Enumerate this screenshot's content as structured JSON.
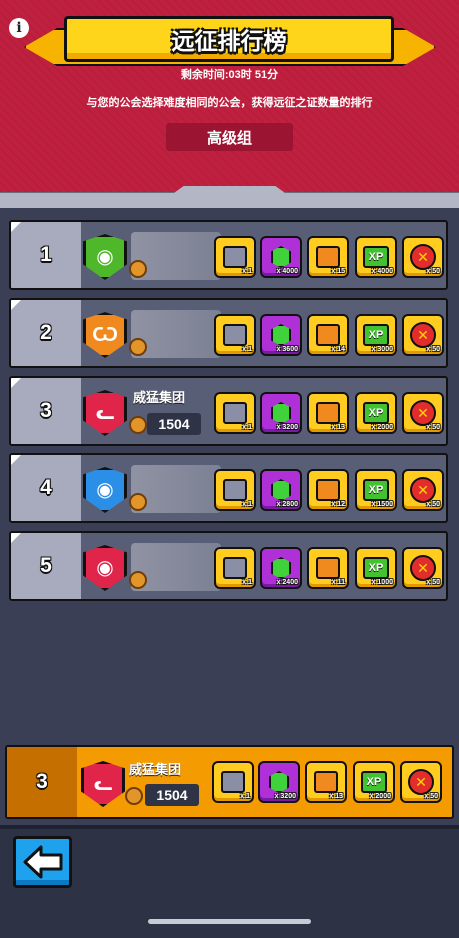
{
  "header": {
    "title": "远征排行榜",
    "remaining_time": "剩余时间:03时 51分",
    "description": "与您的公会选择难度相同的公会，获得远征之证数量的排行",
    "group_label": "高级组",
    "info_icon": "i"
  },
  "colors": {
    "header_red": "#c0203f",
    "title_yellow": "#ffd51c",
    "row_bg": "#585e76",
    "highlight_orange": "#f39b00",
    "back_blue": "#1fa2ee"
  },
  "rows": [
    {
      "rank": "1",
      "badge_color": "#4fb82a",
      "badge_icon": "raccoon-icon",
      "name": "",
      "trophies": "",
      "rewards": [
        "x 1",
        "x 4000",
        "x 15",
        "x 4000",
        "x 50"
      ]
    },
    {
      "rank": "2",
      "badge_color": "#f08a1e",
      "badge_icon": "bull-icon",
      "name": "",
      "trophies": "",
      "rewards": [
        "x 1",
        "x 3600",
        "x 14",
        "x 3000",
        "x 50"
      ]
    },
    {
      "rank": "3",
      "badge_color": "#e0244a",
      "badge_icon": "cat-icon",
      "name": "威猛集团",
      "trophies": "1504",
      "rewards": [
        "x 1",
        "x 3200",
        "x 13",
        "x 2000",
        "x 50"
      ]
    },
    {
      "rank": "4",
      "badge_color": "#2b8fe8",
      "badge_icon": "raccoon-icon",
      "name": "",
      "trophies": "",
      "rewards": [
        "x 1",
        "x 2800",
        "x 12",
        "x 1500",
        "x 50"
      ]
    },
    {
      "rank": "5",
      "badge_color": "#e0244a",
      "badge_icon": "raccoon-icon",
      "name": "",
      "trophies": "",
      "rewards": [
        "x 1",
        "x 2400",
        "x 11",
        "x 1000",
        "x 50"
      ]
    }
  ],
  "my_club": {
    "rank": "3",
    "name": "威猛集团",
    "trophies": "1504",
    "rewards": [
      "x 1",
      "x 3200",
      "x 13",
      "x 2000",
      "x 50"
    ]
  },
  "reward_labels": {
    "xp": "XP",
    "token": "✕"
  },
  "back_icon": "←"
}
